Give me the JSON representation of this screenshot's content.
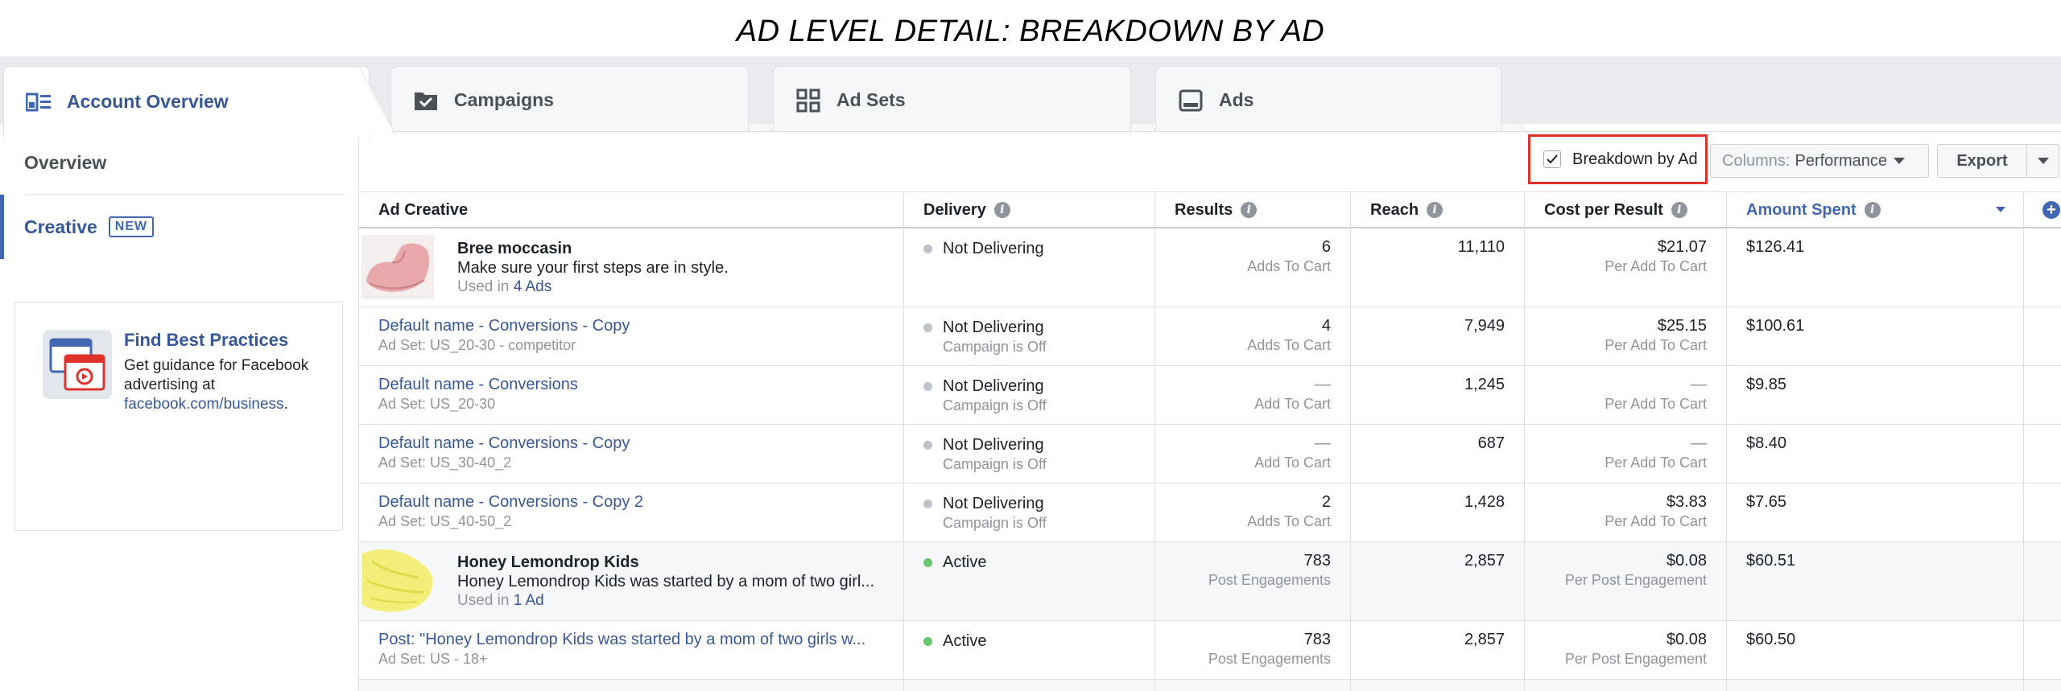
{
  "page_title": "AD LEVEL DETAIL: BREAKDOWN BY AD",
  "tabs": [
    {
      "label": "Account Overview",
      "icon": "account-overview-icon"
    },
    {
      "label": "Campaigns",
      "icon": "campaigns-icon"
    },
    {
      "label": "Ad Sets",
      "icon": "ad-sets-icon"
    },
    {
      "label": "Ads",
      "icon": "ads-icon"
    }
  ],
  "sidebar": {
    "items": [
      {
        "label": "Overview"
      },
      {
        "label": "Creative",
        "badge": "NEW"
      }
    ],
    "promo": {
      "title": "Find Best Practices",
      "text": "Get guidance for Facebook advertising at",
      "link": "facebook.com/business",
      "suffix": "."
    }
  },
  "toolbar": {
    "breakdown_label": "Breakdown by Ad",
    "columns_prefix": "Columns:",
    "columns_value": "Performance",
    "export_label": "Export"
  },
  "table": {
    "headers": {
      "creative": "Ad Creative",
      "delivery": "Delivery",
      "results": "Results",
      "reach": "Reach",
      "cpr": "Cost per Result",
      "spent": "Amount Spent"
    },
    "rows": [
      {
        "kind": "creative",
        "name": "Bree moccasin",
        "desc": "Make sure your first steps are in style.",
        "used_prefix": "Used in",
        "used_link": "4 Ads",
        "delivery": "Not Delivering",
        "delivery_sub": "",
        "status": "grey",
        "results": "6",
        "results_sub": "Adds To Cart",
        "reach": "11,110",
        "cpr": "$21.07",
        "cpr_sub": "Per Add To Cart",
        "spent": "$126.41"
      },
      {
        "kind": "ad",
        "name": "Default name - Conversions - Copy",
        "ad_set": "Ad Set: US_20-30 - competitor",
        "delivery": "Not Delivering",
        "delivery_sub": "Campaign is Off",
        "status": "grey",
        "results": "4",
        "results_sub": "Adds To Cart",
        "reach": "7,949",
        "cpr": "$25.15",
        "cpr_sub": "Per Add To Cart",
        "spent": "$100.61"
      },
      {
        "kind": "ad",
        "name": "Default name - Conversions",
        "ad_set": "Ad Set: US_20-30",
        "delivery": "Not Delivering",
        "delivery_sub": "Campaign is Off",
        "status": "grey",
        "results": "—",
        "results_sub": "Add To Cart",
        "reach": "1,245",
        "cpr": "—",
        "cpr_sub": "Per Add To Cart",
        "spent": "$9.85"
      },
      {
        "kind": "ad",
        "name": "Default name - Conversions - Copy",
        "ad_set": "Ad Set: US_30-40_2",
        "delivery": "Not Delivering",
        "delivery_sub": "Campaign is Off",
        "status": "grey",
        "results": "—",
        "results_sub": "Add To Cart",
        "reach": "687",
        "cpr": "—",
        "cpr_sub": "Per Add To Cart",
        "spent": "$8.40"
      },
      {
        "kind": "ad",
        "name": "Default name - Conversions - Copy 2",
        "ad_set": "Ad Set: US_40-50_2",
        "delivery": "Not Delivering",
        "delivery_sub": "Campaign is Off",
        "status": "grey",
        "results": "2",
        "results_sub": "Adds To Cart",
        "reach": "1,428",
        "cpr": "$3.83",
        "cpr_sub": "Per Add To Cart",
        "spent": "$7.65"
      },
      {
        "kind": "creative",
        "name": "Honey Lemondrop Kids",
        "desc": "Honey Lemondrop Kids was started by a mom of two girl...",
        "used_prefix": "Used in",
        "used_link": "1 Ad",
        "delivery": "Active",
        "delivery_sub": "",
        "status": "green",
        "results": "783",
        "results_sub": "Post Engagements",
        "reach": "2,857",
        "cpr": "$0.08",
        "cpr_sub": "Per Post Engagement",
        "spent": "$60.51"
      },
      {
        "kind": "ad",
        "name": "Post: \"Honey Lemondrop Kids was started by a mom of two girls w...",
        "ad_set": "Ad Set: US - 18+",
        "delivery": "Active",
        "delivery_sub": "",
        "status": "green",
        "results": "783",
        "results_sub": "Post Engagements",
        "reach": "2,857",
        "cpr": "$0.08",
        "cpr_sub": "Per Post Engagement",
        "spent": "$60.50"
      }
    ]
  }
}
